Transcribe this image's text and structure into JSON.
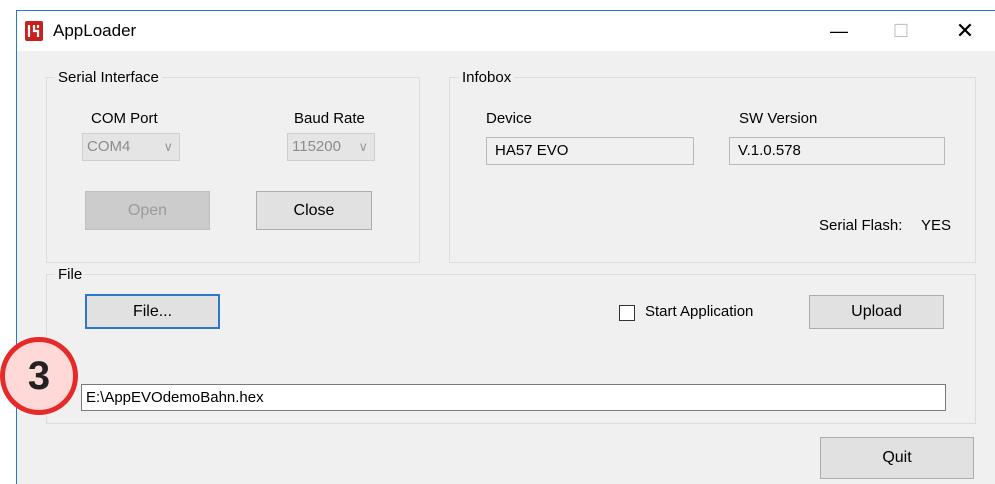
{
  "window": {
    "title": "AppLoader",
    "icon": "apploader-logo-icon",
    "controls": {
      "minimize": "—",
      "maximize": "☐",
      "close": "✕"
    }
  },
  "serial_interface": {
    "legend": "Serial Interface",
    "com_port_label": "COM Port",
    "com_port_value": "COM4",
    "baud_rate_label": "Baud Rate",
    "baud_rate_value": "115200",
    "open_label": "Open",
    "close_label": "Close"
  },
  "infobox": {
    "legend": "Infobox",
    "device_label": "Device",
    "device_value": "HA57 EVO",
    "sw_version_label": "SW Version",
    "sw_version_value": "V.1.0.578",
    "serial_flash_label": "Serial Flash:",
    "serial_flash_value": "YES"
  },
  "file": {
    "legend": "File",
    "file_button_label": "File...",
    "start_application_label": "Start Application",
    "start_application_checked": false,
    "upload_label": "Upload",
    "path_value": "E:\\AppEVOdemoBahn.hex"
  },
  "quit_label": "Quit",
  "annotation": {
    "step_number": "3",
    "color": "#e62a2a"
  },
  "colors": {
    "accent": "#2b78c9",
    "window_bg": "#f0f0f0"
  }
}
